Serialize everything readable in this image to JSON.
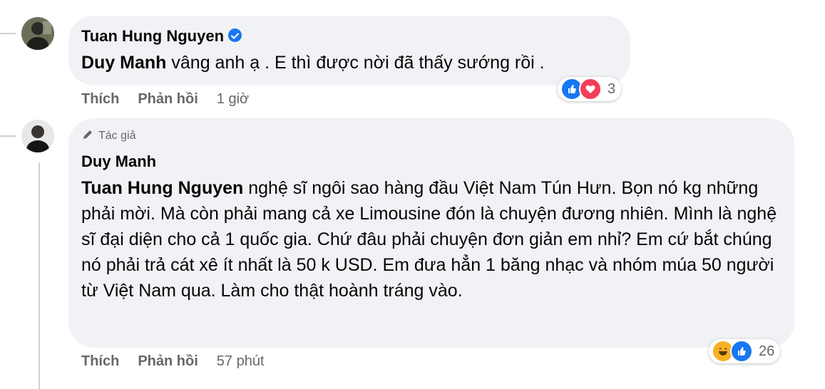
{
  "comments": [
    {
      "author": "Tuan Hung Nguyen",
      "verified": true,
      "mention": "Duy Manh",
      "text": " vâng anh ạ . E thì được nời đã thấy sướng rồi .",
      "actions": {
        "like": "Thích",
        "reply": "Phản hồi",
        "time": "1 giờ"
      },
      "reactions": {
        "icons": [
          "like-icon",
          "love-icon"
        ],
        "count": "3"
      }
    },
    {
      "badge": "Tác giả",
      "author": "Duy Manh",
      "mention": "Tuan Hung Nguyen",
      "text": " nghệ sĩ ngôi sao hàng đầu Việt Nam Tún Hưn. Bọn nó kg những phải mời. Mà còn phải mang cả xe Limousine đón là chuyện đương nhiên. Mình là nghệ sĩ đại diện cho cả 1 quốc gia. Chứ đâu phải chuyện đơn giản em nhỉ? Em cứ bắt chúng nó phải trả cát xê ít nhất là 50 k USD. Em đưa hẳn 1 băng nhạc và nhóm múa 50 người từ Việt Nam qua. Làm cho thật hoành tráng vào.",
      "actions": {
        "like": "Thích",
        "reply": "Phản hồi",
        "time": "57 phút"
      },
      "reactions": {
        "icons": [
          "haha-icon",
          "like-icon"
        ],
        "count": "26"
      }
    }
  ],
  "colors": {
    "bubble": "#f0f2f5",
    "meta": "#65676b",
    "like": "#1877f2",
    "love": "#f33e58",
    "haha": "#f7b125"
  }
}
